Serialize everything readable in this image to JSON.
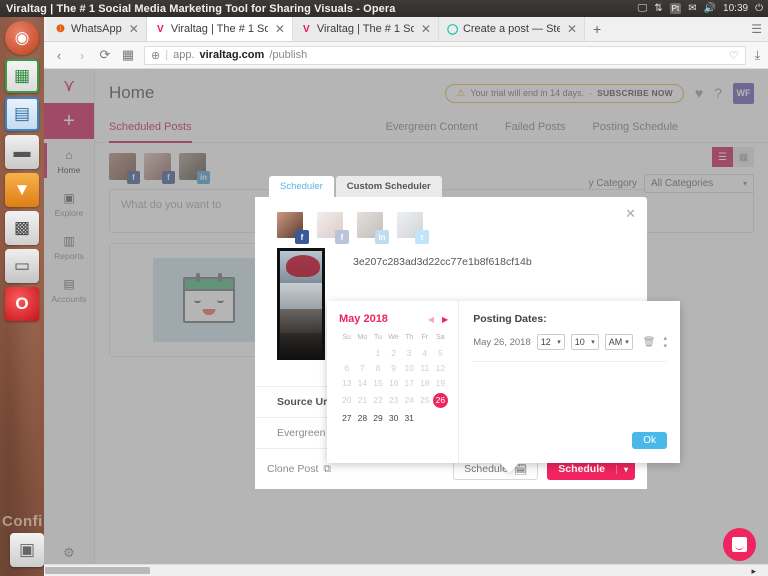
{
  "os": {
    "window_title": "Viraltag | The # 1 Social Media Marketing Tool for Sharing Visuals - Opera",
    "tray": {
      "display_icon": "display-icon",
      "network_icon": "network-updown-icon",
      "keyboard_layout": "Pt",
      "mail_icon": "mail-icon",
      "volume_icon": "volume-icon",
      "clock": "10:39",
      "power_icon": "power-icon"
    },
    "launcher": {
      "items": [
        {
          "name": "ubuntu-dash",
          "glyph": "◉",
          "color": "#dd4814"
        },
        {
          "name": "libreoffice-calc",
          "glyph": "▦",
          "color": "#3a9b48"
        },
        {
          "name": "libreoffice-impress",
          "glyph": "▤",
          "color": "#3b85c6"
        },
        {
          "name": "printer",
          "glyph": "▬",
          "color": "#8d8d8d"
        },
        {
          "name": "downloads",
          "glyph": "▼",
          "color": "#e68a2e"
        },
        {
          "name": "calculator",
          "glyph": "▩",
          "color": "#c9c9c9"
        },
        {
          "name": "files",
          "glyph": "▭",
          "color": "#c2c2c2"
        },
        {
          "name": "opera",
          "glyph": "O",
          "color": "#e02b36"
        },
        {
          "name": "trash",
          "glyph": "▣",
          "color": "#d8d8d8"
        }
      ],
      "wallpaper_text": "Confi"
    }
  },
  "browser": {
    "tabs": [
      {
        "title": "WhatsApp",
        "favicon": "whatsapp-icon",
        "active": false
      },
      {
        "title": "Viraltag | The # 1 Soc",
        "favicon": "viraltag-icon",
        "active": true
      },
      {
        "title": "Viraltag | The # 1 Soc",
        "favicon": "viraltag-icon",
        "active": false
      },
      {
        "title": "Create a post — Stee",
        "favicon": "steemit-icon",
        "active": false
      }
    ],
    "new_tab_label": "+",
    "nav": {
      "back": "‹",
      "forward": "›",
      "reload": "⟳",
      "speeddial": "▦"
    },
    "url": {
      "prefix": "app.",
      "domain": "viraltag.com",
      "path": "/publish"
    },
    "heart_icon": "heart-icon",
    "download_icon": "download-icon"
  },
  "app": {
    "sidebar": {
      "logo": "viraltag-logo",
      "create_label": "+",
      "items": [
        {
          "label": "Home",
          "icon": "home-icon",
          "active": true
        },
        {
          "label": "Explore",
          "icon": "explore-icon",
          "active": false
        },
        {
          "label": "Reports",
          "icon": "reports-icon",
          "active": false
        },
        {
          "label": "Accounts",
          "icon": "accounts-icon",
          "active": false
        }
      ],
      "settings_icon": "gear-icon"
    },
    "header": {
      "title": "Home",
      "trial_text": "Your trial will end in 14 days.",
      "trial_separator": "·",
      "subscribe_label": "SUBSCRIBE NOW",
      "heart_icon": "heart-icon",
      "help_icon": "help-icon",
      "avatar_initials": "WF"
    },
    "tabs": [
      {
        "label": "Scheduled Posts",
        "active": true
      },
      {
        "label": "Evergreen Content",
        "active": false
      },
      {
        "label": "Failed Posts",
        "active": false
      },
      {
        "label": "Posting Schedule",
        "active": false
      }
    ],
    "composer_placeholder": "What do you want to",
    "accounts": [
      {
        "network": "facebook",
        "badge": "f"
      },
      {
        "network": "facebook",
        "badge": "f"
      },
      {
        "network": "linkedin",
        "badge": "in"
      }
    ],
    "filters": {
      "list_view_icon": "list-view-icon",
      "grid_view_icon": "grid-view-icon",
      "category_label": "y Category",
      "category_value": "All Categories",
      "caret": "▾"
    }
  },
  "modal": {
    "tabs": [
      {
        "label": "Scheduler",
        "active": true
      },
      {
        "label": "Custom Scheduler",
        "active": false
      }
    ],
    "close_icon": "close-icon",
    "accounts": [
      {
        "network": "facebook",
        "badge": "f",
        "selected": true
      },
      {
        "network": "facebook",
        "badge": "f",
        "selected": false
      },
      {
        "network": "linkedin",
        "badge": "in",
        "selected": false
      },
      {
        "network": "twitter",
        "badge": "t",
        "selected": false
      }
    ],
    "post_text": "3e207c283ad3d22cc77e1b8f618cf14b",
    "source_url_label": "Source Url:",
    "evergreen_label": "Evergreen",
    "clone_post_label": "Clone Post",
    "clone_icon": "copy-icon",
    "schedule_picker_label": "Schedule",
    "schedule_picker_icon": "calendar-icon",
    "schedule_button_label": "Schedule",
    "schedule_button_caret": "▾"
  },
  "date_popover": {
    "month_label": "May 2018",
    "prev_arrow": "◀",
    "next_arrow": "▶",
    "weekdays": [
      "Su",
      "Mo",
      "Tu",
      "We",
      "Th",
      "Fr",
      "Sa"
    ],
    "weeks": [
      [
        null,
        null,
        1,
        2,
        3,
        4,
        5
      ],
      [
        6,
        7,
        8,
        9,
        10,
        11,
        12
      ],
      [
        13,
        14,
        15,
        16,
        17,
        18,
        19
      ],
      [
        20,
        21,
        22,
        23,
        24,
        25,
        26
      ],
      [
        27,
        28,
        29,
        30,
        31,
        null,
        null
      ]
    ],
    "selected_day": 26,
    "enabled_from": 27,
    "posting_dates_title": "Posting Dates:",
    "date_text": "May 26, 2018",
    "hour_value": "12",
    "minute_value": "10",
    "meridiem_value": "AM",
    "select_caret": "▾",
    "delete_icon": "trash-icon",
    "spinner_up": "▴",
    "spinner_down": "▾",
    "ok_label": "Ok",
    "accent_color": "#f0245e",
    "ok_color": "#4ab9e8"
  },
  "intercom": {
    "icon": "intercom-chat-icon"
  },
  "scrollbar": {
    "cursor": "▸"
  }
}
